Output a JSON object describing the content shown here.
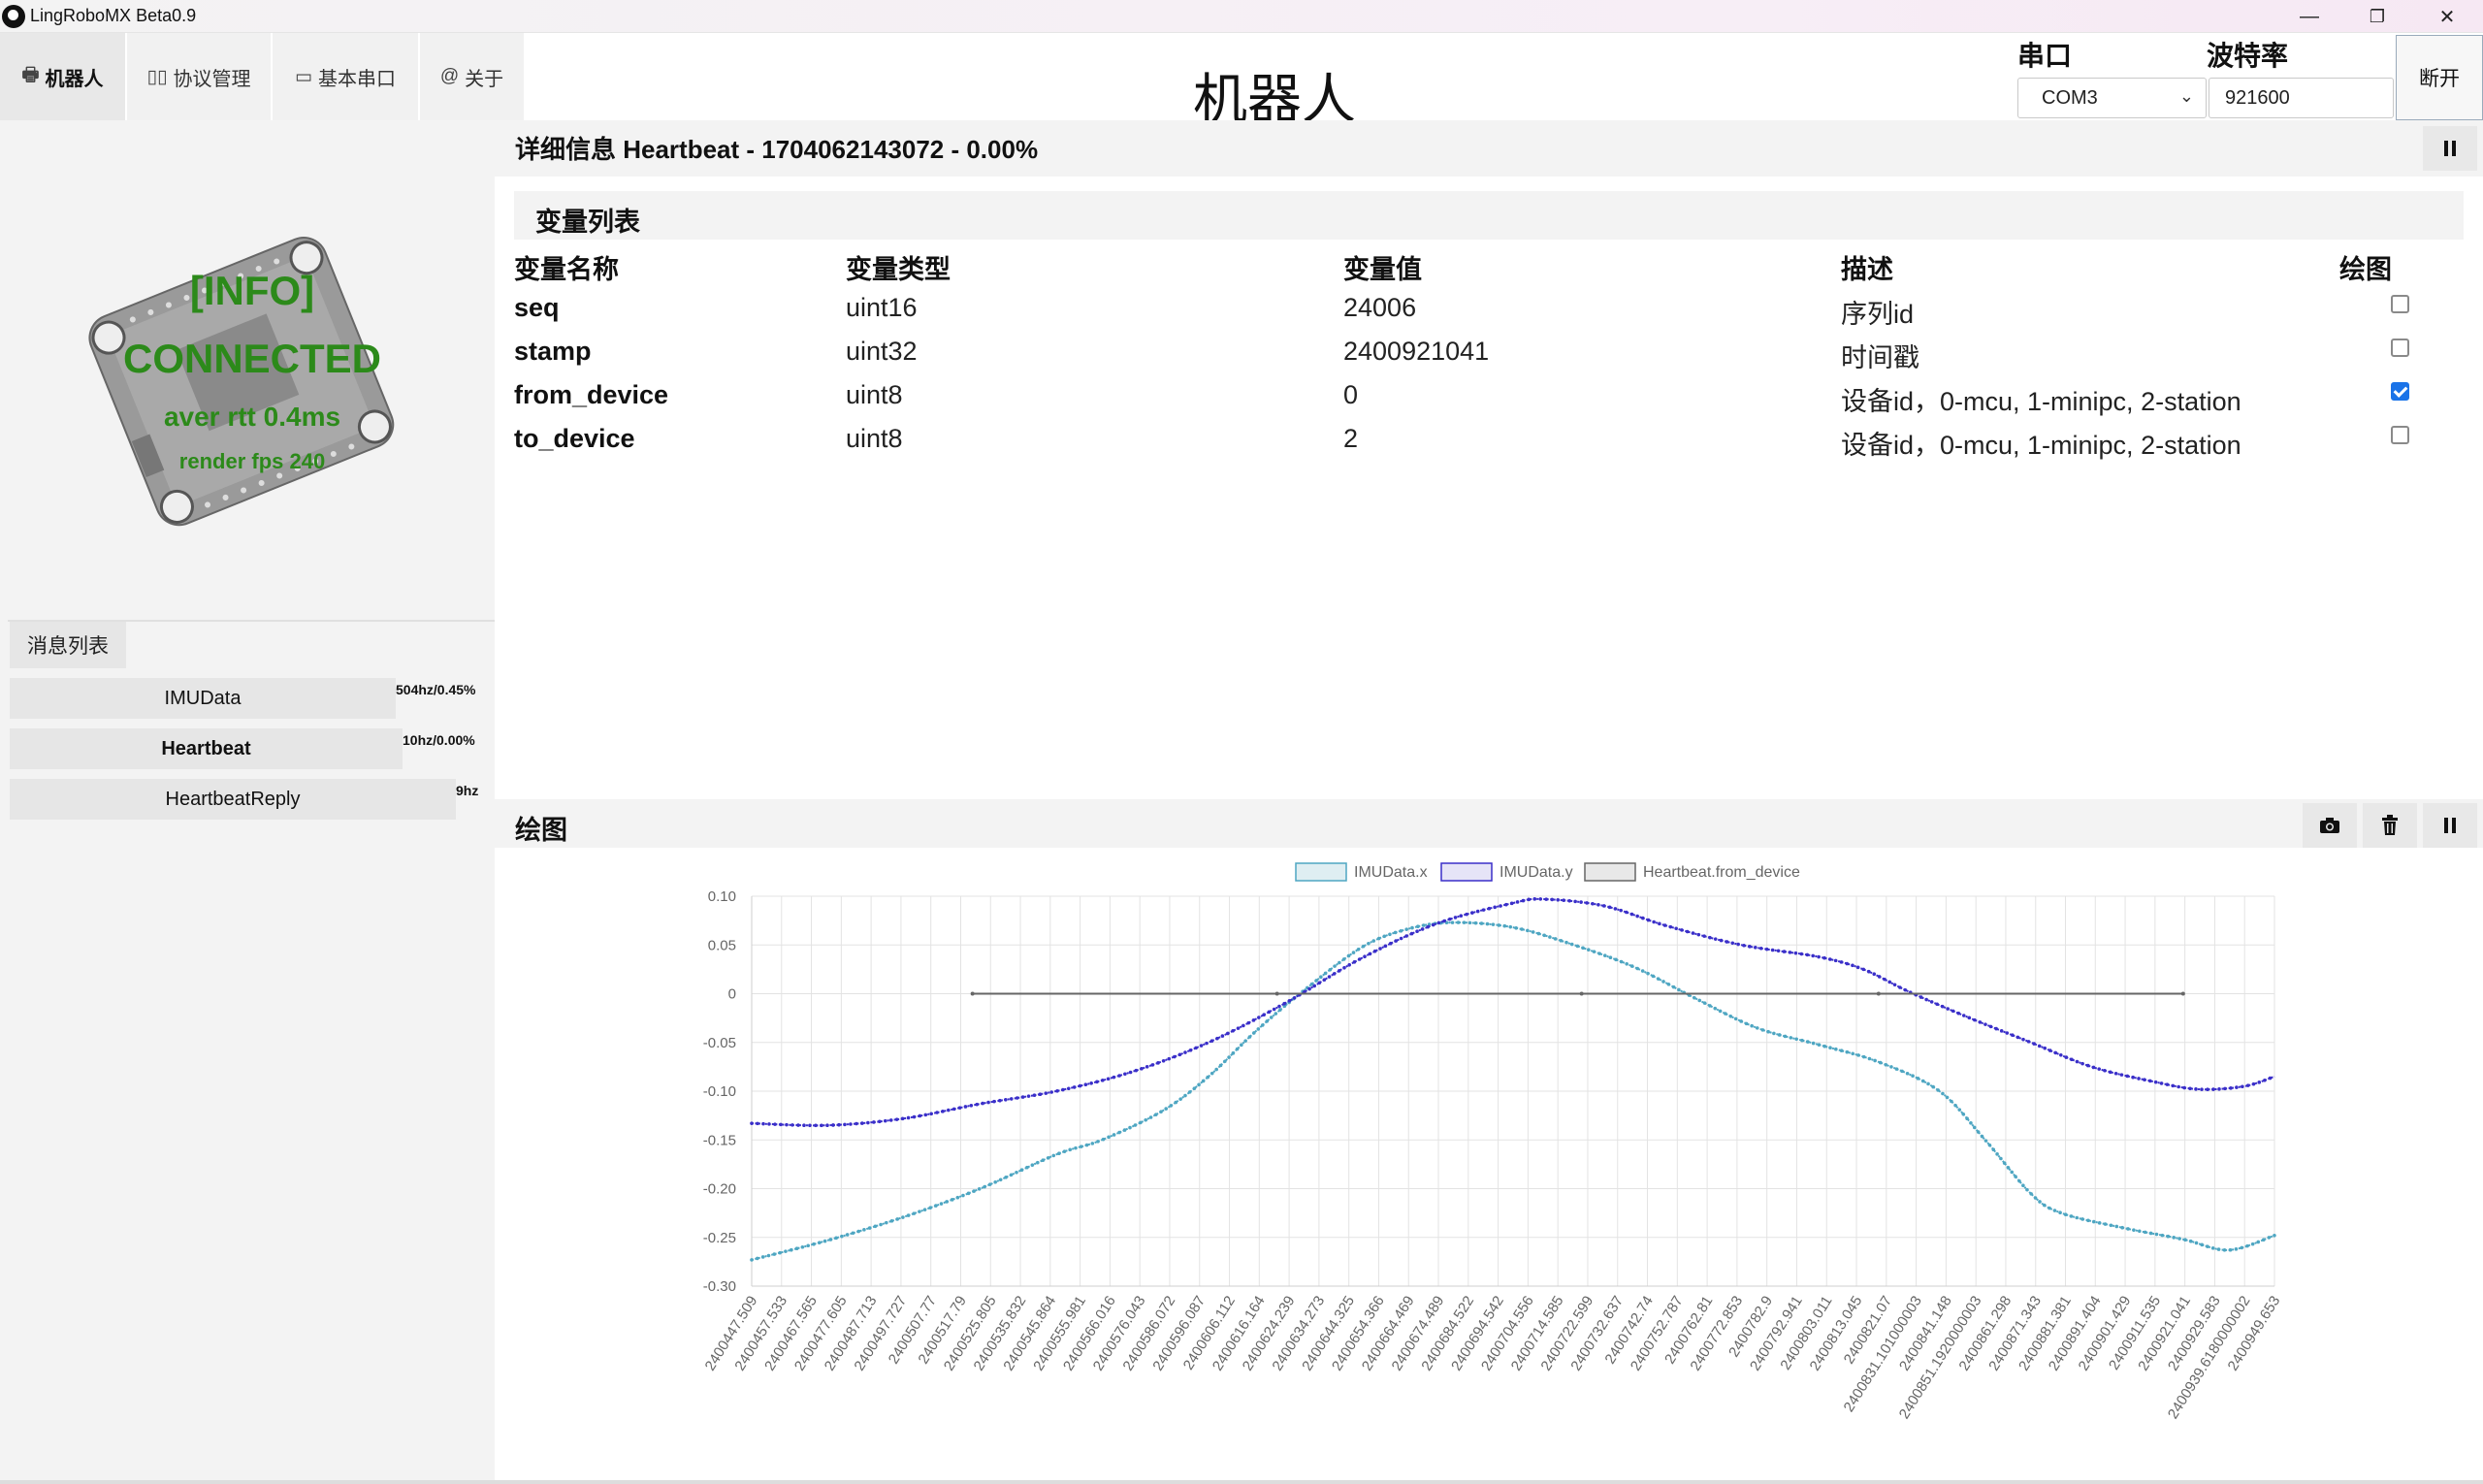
{
  "window": {
    "title": "LingRoboMX Beta0.9",
    "minimize": "—",
    "restore": "❐",
    "close": "✕"
  },
  "nav": {
    "tabs": [
      {
        "label": "机器人",
        "icon": "printer-icon"
      },
      {
        "label": "协议管理",
        "icon": "columns-icon"
      },
      {
        "label": "基本串口",
        "icon": "router-icon"
      },
      {
        "label": "关于",
        "icon": "at-icon"
      }
    ]
  },
  "page_title": "机器人",
  "serial": {
    "port_label": "串口",
    "baud_label": "波特率",
    "port_value": "COM3",
    "baud_value": "921600",
    "disconnect_label": "断开"
  },
  "status": {
    "info": "[INFO]",
    "connected": "CONNECTED",
    "rtt": "aver rtt 0.4ms",
    "fps": "render fps 240",
    "color": "#2c8a1a"
  },
  "messages": {
    "header": "消息列表",
    "items": [
      {
        "name": "IMUData",
        "rate": "504hz/0.45%"
      },
      {
        "name": "Heartbeat",
        "rate": "10hz/0.00%"
      },
      {
        "name": "HeartbeatReply",
        "rate": "9hz"
      }
    ]
  },
  "detail": {
    "title": "详细信息 Heartbeat - 1704062143072 - 0.00%",
    "var_list_header": "变量列表",
    "columns": [
      "变量名称",
      "变量类型",
      "变量值",
      "描述",
      "绘图"
    ],
    "rows": [
      {
        "name": "seq",
        "type": "uint16",
        "value": "24006",
        "desc": "序列id",
        "plot": false
      },
      {
        "name": "stamp",
        "type": "uint32",
        "value": "2400921041",
        "desc": "时间戳",
        "plot": false
      },
      {
        "name": "from_device",
        "type": "uint8",
        "value": "0",
        "desc": "设备id，0-mcu, 1-minipc, 2-station",
        "plot": true
      },
      {
        "name": "to_device",
        "type": "uint8",
        "value": "2",
        "desc": "设备id，0-mcu, 1-minipc, 2-station",
        "plot": false
      }
    ]
  },
  "plot": {
    "title": "绘图",
    "buttons": [
      "camera-icon",
      "trash-icon",
      "pause-icon"
    ]
  },
  "chart_data": {
    "type": "line",
    "legend": [
      "IMUData.x",
      "IMUData.y",
      "Heartbeat.from_device"
    ],
    "legend_position": "top",
    "grid": true,
    "ylim": [
      -0.3,
      0.1
    ],
    "yticks": [
      "0.10",
      "0.05",
      "0",
      "-0.05",
      "-0.10",
      "-0.15",
      "-0.20",
      "-0.25",
      "-0.30"
    ],
    "x_tick_labels": [
      "2400447.509",
      "2400457.533",
      "2400467.565",
      "2400477.605",
      "2400487.713",
      "2400497.727",
      "2400507.77",
      "2400517.79",
      "2400525.805",
      "2400535.832",
      "2400545.864",
      "2400555.981",
      "2400566.016",
      "2400576.043",
      "2400586.072",
      "2400596.087",
      "2400606.112",
      "2400616.164",
      "2400624.239",
      "2400634.273",
      "2400644.325",
      "2400654.366",
      "2400664.469",
      "2400674.489",
      "2400684.522",
      "2400694.542",
      "2400704.556",
      "2400714.585",
      "2400722.599",
      "2400732.637",
      "2400742.74",
      "2400752.787",
      "2400762.81",
      "2400772.853",
      "2400782.9",
      "2400792.941",
      "2400803.011",
      "2400813.045",
      "2400821.07",
      "2400831.101000003",
      "2400841.148",
      "2400851.1920000003",
      "2400861.298",
      "2400871.343",
      "2400881.381",
      "2400891.404",
      "2400901.429",
      "2400911.535",
      "2400921.041",
      "2400929.583",
      "2400939.6180000002",
      "2400949.653"
    ],
    "series": [
      {
        "name": "IMUData.x",
        "color": "#4ea6c2",
        "points": [
          [
            0,
            -0.273
          ],
          [
            0.05,
            -0.253
          ],
          [
            0.1,
            -0.229
          ],
          [
            0.15,
            -0.2
          ],
          [
            0.2,
            -0.165
          ],
          [
            0.23,
            -0.15
          ],
          [
            0.27,
            -0.12
          ],
          [
            0.3,
            -0.085
          ],
          [
            0.33,
            -0.04
          ],
          [
            0.36,
            0.0
          ],
          [
            0.4,
            0.047
          ],
          [
            0.43,
            0.066
          ],
          [
            0.46,
            0.073
          ],
          [
            0.5,
            0.068
          ],
          [
            0.54,
            0.05
          ],
          [
            0.58,
            0.027
          ],
          [
            0.62,
            -0.005
          ],
          [
            0.66,
            -0.035
          ],
          [
            0.7,
            -0.052
          ],
          [
            0.74,
            -0.07
          ],
          [
            0.78,
            -0.1
          ],
          [
            0.81,
            -0.15
          ],
          [
            0.84,
            -0.205
          ],
          [
            0.86,
            -0.225
          ],
          [
            0.9,
            -0.24
          ],
          [
            0.94,
            -0.252
          ],
          [
            0.97,
            -0.263
          ],
          [
            1.0,
            -0.248
          ]
        ]
      },
      {
        "name": "IMUData.y",
        "color": "#3a2fc9",
        "points": [
          [
            0,
            -0.133
          ],
          [
            0.05,
            -0.135
          ],
          [
            0.1,
            -0.128
          ],
          [
            0.15,
            -0.113
          ],
          [
            0.2,
            -0.1
          ],
          [
            0.25,
            -0.08
          ],
          [
            0.3,
            -0.05
          ],
          [
            0.35,
            -0.01
          ],
          [
            0.4,
            0.036
          ],
          [
            0.45,
            0.072
          ],
          [
            0.5,
            0.093
          ],
          [
            0.52,
            0.097
          ],
          [
            0.56,
            0.09
          ],
          [
            0.6,
            0.07
          ],
          [
            0.65,
            0.05
          ],
          [
            0.7,
            0.038
          ],
          [
            0.73,
            0.025
          ],
          [
            0.76,
            0.002
          ],
          [
            0.8,
            -0.025
          ],
          [
            0.84,
            -0.05
          ],
          [
            0.88,
            -0.075
          ],
          [
            0.92,
            -0.09
          ],
          [
            0.95,
            -0.098
          ],
          [
            0.98,
            -0.095
          ],
          [
            1.0,
            -0.085
          ]
        ]
      },
      {
        "name": "Heartbeat.from_device",
        "color": "#666666",
        "points": [
          [
            0.145,
            0
          ],
          [
            0.345,
            0
          ],
          [
            0.545,
            0
          ],
          [
            0.74,
            0
          ],
          [
            0.94,
            0
          ]
        ]
      }
    ]
  }
}
